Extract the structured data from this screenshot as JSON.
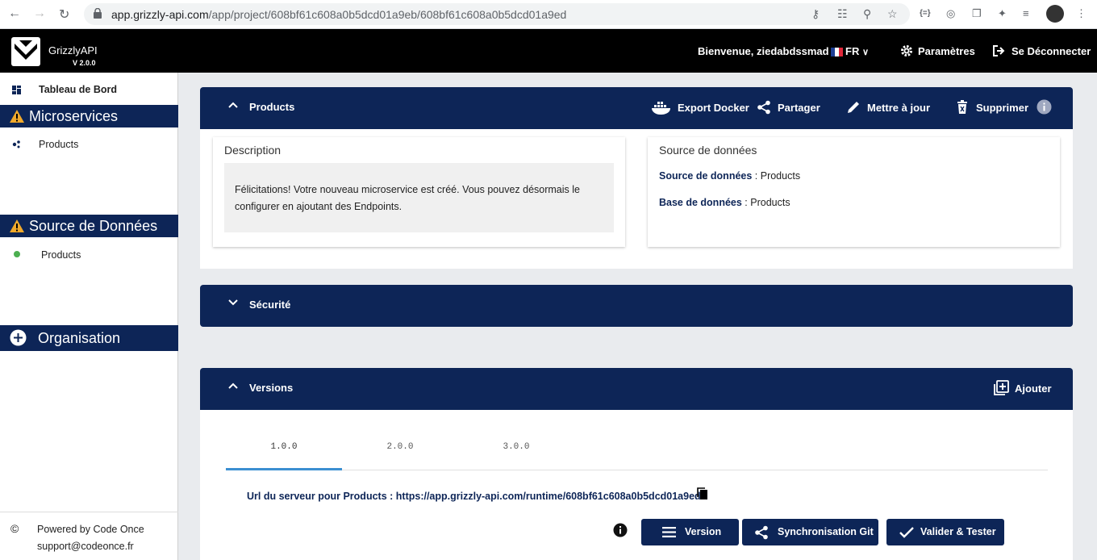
{
  "browser": {
    "url_host": "app.grizzly-api.com",
    "url_path": "/app/project/608bf61c608a0b5dcd01a9eb/608bf61c608a0b5dcd01a9ed",
    "extension_badge": "{=}"
  },
  "topbar": {
    "brand": "GrizzlyAPI",
    "version": "V 2.0.0",
    "welcome": "Bienvenue,",
    "username": "ziedabdssmad",
    "language": "FR",
    "settings_label": "Paramètres",
    "logout_label": "Se Déconnecter"
  },
  "sidebar": {
    "dashboard_label": "Tableau de Bord",
    "microservices_header": "Microservices",
    "microservices_items": [
      "Products"
    ],
    "datasource_header": "Source de Données",
    "datasource_items": [
      "Products"
    ],
    "organisation_header": "Organisation",
    "footer_powered": "Powered by Code Once",
    "footer_email": "support@codeonce.fr"
  },
  "products_panel": {
    "title": "Products",
    "actions": {
      "export_docker": "Export Docker",
      "share": "Partager",
      "update": "Mettre à jour",
      "delete": "Supprimer"
    },
    "description_title": "Description",
    "description_text": "Félicitations! Votre nouveau microservice est créé. Vous pouvez désormais le configurer en ajoutant des Endpoints.",
    "datasource_card_title": "Source de données",
    "datasource_label": "Source de données",
    "datasource_value": "Products",
    "database_label": "Base de données",
    "database_value": "Products"
  },
  "security_panel": {
    "title": "Sécurité"
  },
  "versions_panel": {
    "title": "Versions",
    "add_label": "Ajouter",
    "tabs": [
      "1.0.0",
      "2.0.0",
      "3.0.0"
    ],
    "active_tab": "1.0.0",
    "server_url_label": "Url du serveur pour Products :",
    "server_url": "https://app.grizzly-api.com/runtime/608bf61c608a0b5dcd01a9ed",
    "buttons": {
      "version": "Version",
      "git_sync": "Synchronisation Git",
      "validate": "Valider & Tester"
    }
  },
  "colors": {
    "navy": "#0d2557",
    "warning": "#f0a92b",
    "tab_indicator": "#3b8fd1",
    "green_dot": "#4caf50"
  }
}
